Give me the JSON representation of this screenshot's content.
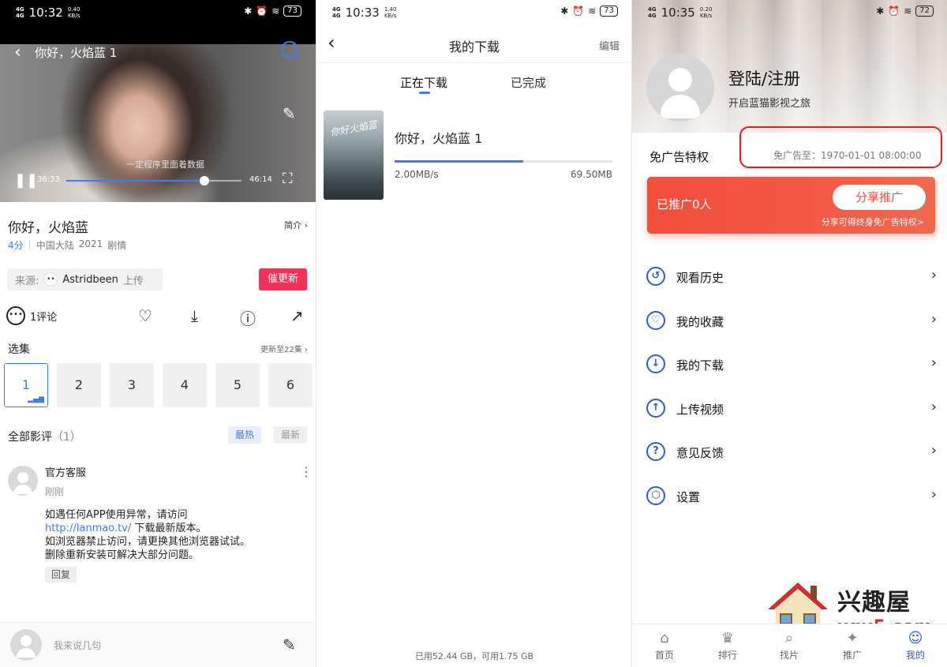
{
  "panel1": {
    "status": {
      "net1": "4G",
      "net2": "4G",
      "time": "10:32",
      "speed": "0.40\nKB/s",
      "battery": "73"
    },
    "player": {
      "title": "你好，火焰蓝 1",
      "subtitle_text": "一定程序里面着数据",
      "current_time": "36:33",
      "total_time": "46:14",
      "progress": 0.79
    },
    "info": {
      "title": "你好，火焰蓝",
      "intro_label": "简介 ›",
      "score": "4分",
      "region": "中国大陆",
      "year": "2021",
      "genre": "剧情"
    },
    "source": {
      "label": "来源:",
      "avatar_text": "••",
      "uploader": "Astridbeen",
      "suffix": "上传",
      "urge_button": "催更新"
    },
    "actions": {
      "comments_label": "1评论"
    },
    "episodes": {
      "heading": "选集",
      "updated": "更新至22集 ›",
      "items": [
        "1",
        "2",
        "3",
        "4",
        "5",
        "6"
      ],
      "playing_indicator": "▂▄▆"
    },
    "reviews": {
      "heading": "全部影评",
      "count": "（1）",
      "sort_hot": "最热",
      "sort_new": "最新",
      "comment": {
        "author": "官方客服",
        "time": "刚刚",
        "line1": "如遇任何APP使用异常，请访问",
        "link": "http://lanmao.tv/",
        "line2_rest": " 下载最新版本。",
        "line3": "如浏览器禁止访问，请更换其他浏览器试试。",
        "line4": "删除重新安装可解决大部分问题。",
        "reply": "回复"
      }
    },
    "input": {
      "placeholder": "我来说几句"
    }
  },
  "panel2": {
    "status": {
      "net1": "4G",
      "net2": "4G",
      "time": "10:33",
      "speed": "1.40\nKB/s",
      "battery": "73"
    },
    "header": {
      "title": "我的下载",
      "edit": "编辑"
    },
    "tabs": {
      "downloading": "正在下载",
      "completed": "已完成"
    },
    "item": {
      "title": "你好，火焰蓝 1",
      "poster_text": "你好火焰蓝",
      "speed": "2.00MB/s",
      "size": "69.50MB",
      "progress": 0.59
    },
    "storage": "已用52.44 GB，可用1.75 GB"
  },
  "panel3": {
    "status": {
      "net1": "4G",
      "net2": "4G",
      "time": "10:35",
      "speed": "0.20\nKB/s",
      "battery": "72"
    },
    "profile": {
      "login": "登陆/注册",
      "tagline": "开启蓝猫影视之旅"
    },
    "ad_free": {
      "title": "免广告特权",
      "until": "免广告至：1970-01-01 08:00:00"
    },
    "promo": {
      "count": "已推广0人",
      "button": "分享推广",
      "note": "分享可得终身免广告特权>"
    },
    "menu": [
      {
        "label": "观看历史",
        "icon": "history-icon",
        "glyph": "↺"
      },
      {
        "label": "我的收藏",
        "icon": "heart-plus-icon",
        "glyph": "♡"
      },
      {
        "label": "我的下载",
        "icon": "download-icon",
        "glyph": "↓"
      },
      {
        "label": "上传视频",
        "icon": "upload-icon",
        "glyph": "↑"
      },
      {
        "label": "意见反馈",
        "icon": "question-icon",
        "glyph": "?"
      },
      {
        "label": "设置",
        "icon": "settings-icon",
        "glyph": "⬡"
      }
    ],
    "tabbar": [
      {
        "label": "首页",
        "glyph": "⌂"
      },
      {
        "label": "排行",
        "glyph": "♛"
      },
      {
        "label": "找片",
        "glyph": "⌕"
      },
      {
        "label": "推广",
        "glyph": "✦"
      },
      {
        "label": "我的",
        "glyph": "☺"
      }
    ],
    "watermark": {
      "brand": "兴趣屋",
      "domain": "xqu5.com"
    }
  },
  "colors": {
    "accent": "#3f7cf0",
    "menu_blue": "#2d5bd8",
    "urge_red": "#f0315a",
    "promo_red": "#f44d3c",
    "highlight_circle": "#e01e1e"
  }
}
